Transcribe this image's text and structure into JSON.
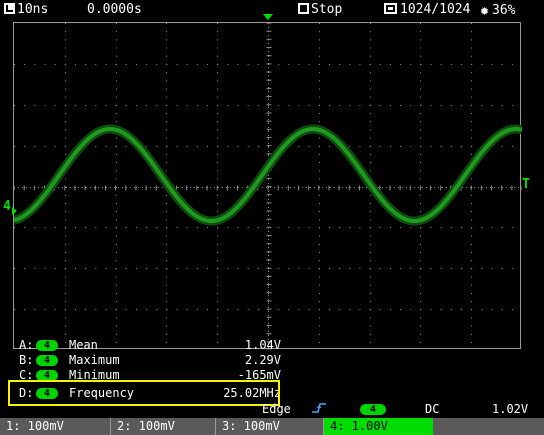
{
  "top_bar": {
    "timebase": "10ns",
    "trigger_time": "0.0000s",
    "run_state": "Stop",
    "memory": "1024/1024",
    "battery": "36%"
  },
  "markers": {
    "channel_label": "4",
    "trigger_level_label": "T"
  },
  "measurements": [
    {
      "slot": "A:",
      "channel": "4",
      "name": "Mean",
      "value": "1.04V"
    },
    {
      "slot": "B:",
      "channel": "4",
      "name": "Maximum",
      "value": "2.29V"
    },
    {
      "slot": "C:",
      "channel": "4",
      "name": "Minimum",
      "value": "-165mV"
    },
    {
      "slot": "D:",
      "channel": "4",
      "name": "Frequency",
      "value": "25.02MHz"
    }
  ],
  "trigger": {
    "type_label": "Edge",
    "channel": "4",
    "coupling": "DC",
    "level": "1.02V"
  },
  "channels": [
    {
      "label": "1: 100mV"
    },
    {
      "label": "2: 100mV"
    },
    {
      "label": "3: 100mV"
    },
    {
      "label": "4: 1.00V"
    }
  ],
  "colors": {
    "trace": "#1f9a1f",
    "channel4": "#00dd00",
    "highlight": "#f5f500",
    "grid_dots": "#8a8a8a"
  },
  "icons": [
    "timebase-icon",
    "stop-icon",
    "memory-icon",
    "settings-gear-icon",
    "rising-edge-icon"
  ]
}
